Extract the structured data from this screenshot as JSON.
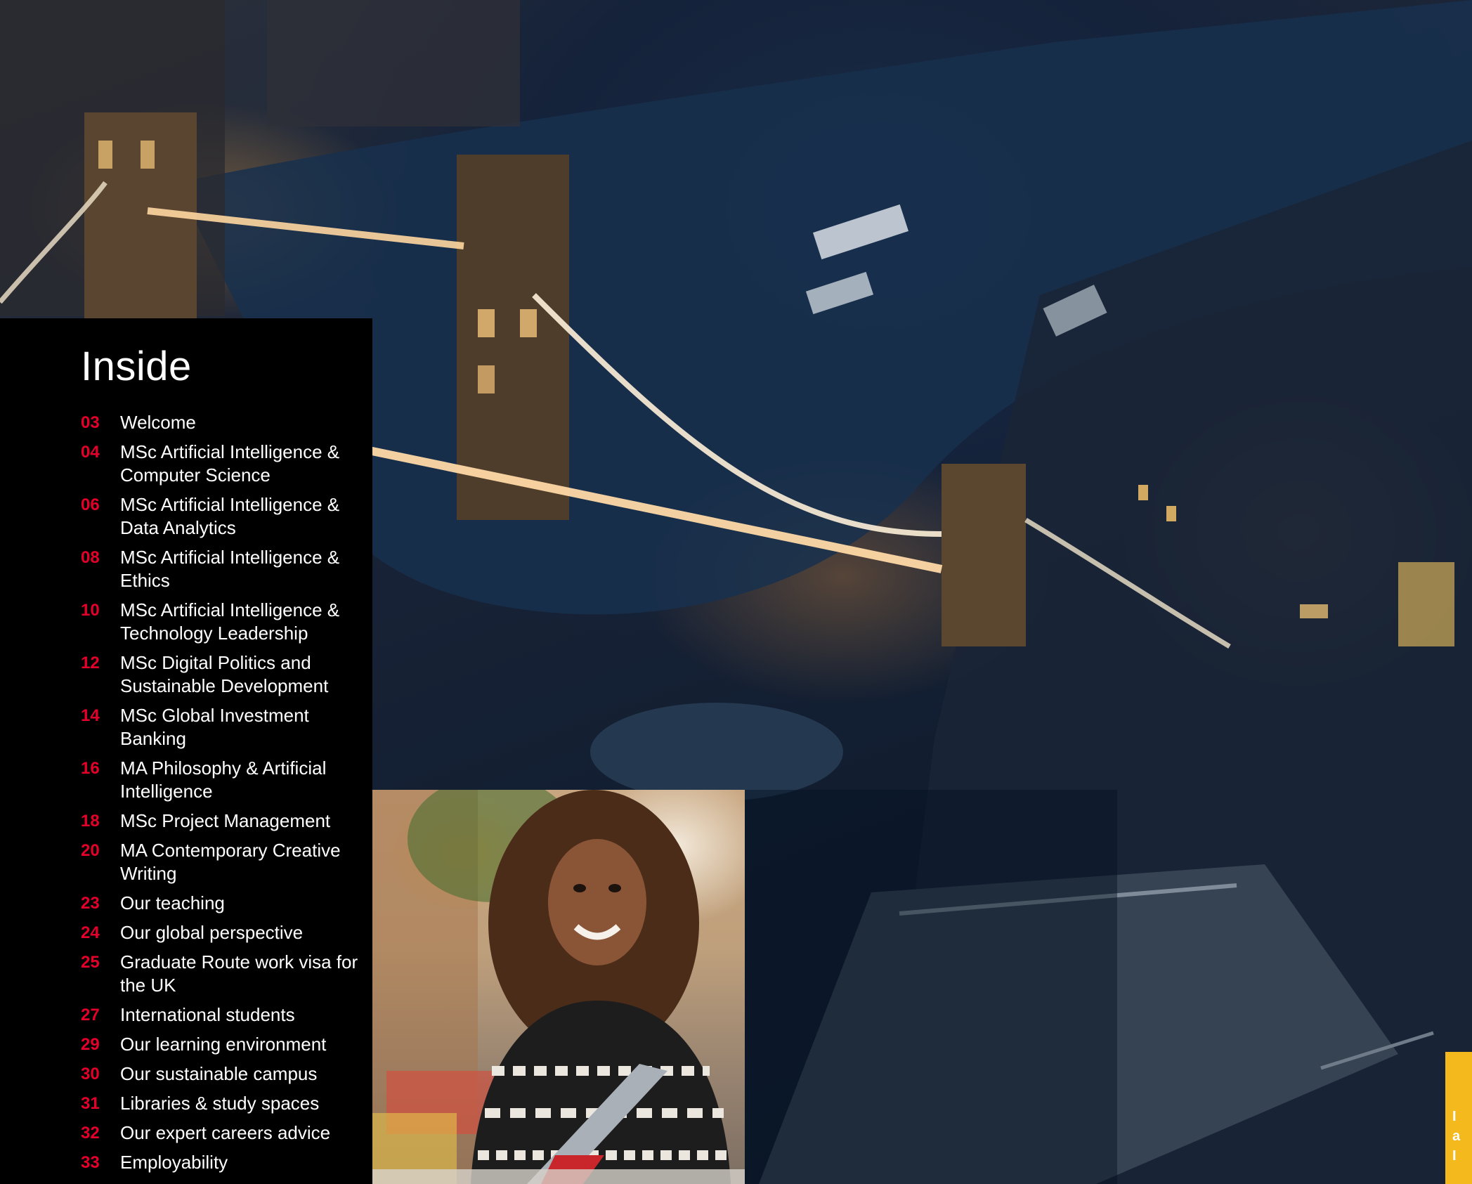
{
  "toc": {
    "title": "Inside",
    "items": [
      {
        "num": "03",
        "label": "Welcome"
      },
      {
        "num": "04",
        "label": "MSc Artificial Intelligence & Computer Science"
      },
      {
        "num": "06",
        "label": "MSc Artificial Intelligence & Data Analytics"
      },
      {
        "num": "08",
        "label": "MSc Artificial Intelligence & Ethics"
      },
      {
        "num": "10",
        "label": "MSc Artificial Intelligence & Technology Leadership"
      },
      {
        "num": "12",
        "label": "MSc Digital Politics and Sustainable Development"
      },
      {
        "num": "14",
        "label": "MSc Global Investment Banking"
      },
      {
        "num": "16",
        "label": "MA Philosophy & Artificial Intelligence"
      },
      {
        "num": "18",
        "label": "MSc Project Management"
      },
      {
        "num": "20",
        "label": "MA Contemporary Creative Writing"
      },
      {
        "num": "23",
        "label": "Our teaching"
      },
      {
        "num": "24",
        "label": "Our global perspective"
      },
      {
        "num": "25",
        "label": "Graduate Route work visa for the UK"
      },
      {
        "num": "27",
        "label": "International students"
      },
      {
        "num": "29",
        "label": "Our learning environment"
      },
      {
        "num": "30",
        "label": "Our sustainable campus"
      },
      {
        "num": "31",
        "label": "Libraries & study spaces"
      },
      {
        "num": "32",
        "label": "Our expert careers advice"
      },
      {
        "num": "33",
        "label": "Employability"
      }
    ]
  },
  "yellow_tab": {
    "text": "I\na\nI"
  },
  "colors": {
    "accent": "#e4002b",
    "panel": "#000000",
    "tab": "#f4b91d"
  }
}
